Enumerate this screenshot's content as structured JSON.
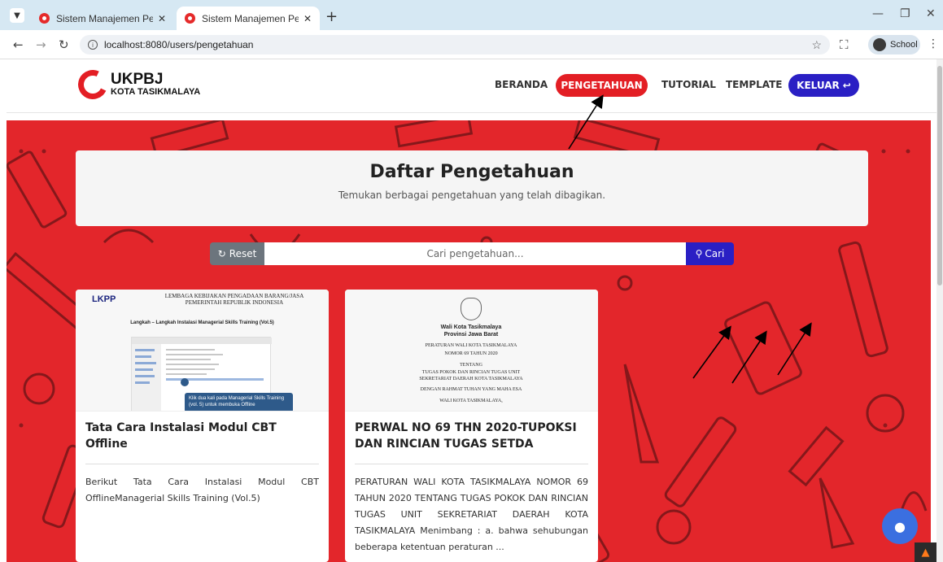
{
  "browser": {
    "tabs": [
      {
        "title": "Sistem Manajemen Pengetahuan",
        "active": false
      },
      {
        "title": "Sistem Manajemen Pengetahuan",
        "active": true
      }
    ],
    "url": "localhost:8080/users/pengetahuan",
    "profile_label": "School"
  },
  "navbar": {
    "logo_line1": "UKPBJ",
    "logo_line2": "KOTA TASIKMALAYA",
    "links": [
      "BERANDA",
      "PENGETAHUAN",
      "TUTORIAL",
      "TEMPLATE"
    ],
    "logout_label": "KELUAR"
  },
  "header": {
    "title": "Daftar Pengetahuan",
    "subtitle": "Temukan berbagai pengetahuan yang telah dibagikan."
  },
  "search": {
    "reset_label": "Reset",
    "placeholder": "Cari pengetahuan...",
    "submit_label": "Cari"
  },
  "cards": [
    {
      "title": "Tata Cara Instalasi Modul CBT Offline",
      "excerpt": "Berikut Tata Cara Instalasi Modul CBT OfflineManagerial Skills Training (Vol.5)",
      "thumb": {
        "brand": "LKPP",
        "header": "LEMBAGA KEBIJAKAN PENGADAAN BARANG/JASA PEMERINTAH REPUBLIK INDONESIA",
        "heading": "Langkah – Langkah Instalasi Managerial Skills Training (Vol.5)",
        "tip": "Klik dua kali pada Managerial Skills Training (vol. 5) untuk membuka Offline"
      }
    },
    {
      "title": "PERWAL NO 69 THN 2020-TUPOKSI DAN RINCIAN TUGAS SETDA",
      "excerpt": "PERATURAN WALI KOTA TASIKMALAYA NOMOR 69 TAHUN 2020 TENTANG TUGAS POKOK DAN RINCIAN TUGAS UNIT SEKRETARIAT DAERAH KOTA TASIKMALAYA Menimbang : a. bahwa sehubungan beberapa ketentuan peraturan ...",
      "thumb": {
        "line1": "Wali Kota Tasikmalaya",
        "line2": "Provinsi Jawa Barat",
        "line3": "PERATURAN WALI KOTA TASIKMALAYA",
        "line4": "NOMOR 69 TAHUN 2020",
        "line5": "TENTANG",
        "line6": "TUGAS POKOK DAN RINCIAN TUGAS UNIT SEKRETARIAT DAERAH KOTA TASIKMALAYA",
        "line7": "DENGAN RAHMAT TUHAN YANG MAHA ESA",
        "line8": "WALI KOTA TASIKMALAYA,"
      }
    }
  ],
  "colors": {
    "hero_red": "#e3262b",
    "primary_blue": "#2a1fc4",
    "accent_red": "#e31e24"
  }
}
